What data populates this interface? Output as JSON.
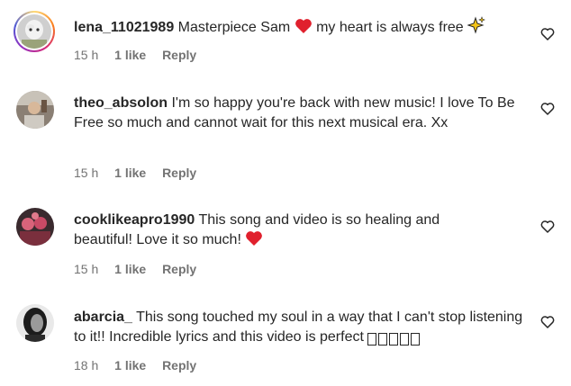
{
  "comments": [
    {
      "username": "lena_11021989",
      "text_before_emoji": "Masterpiece Sam",
      "text_after_emoji": "my heart is always free",
      "time": "15 h",
      "likes": "1 like",
      "reply": "Reply"
    },
    {
      "username": "theo_absolon",
      "text": "I'm so happy you're back with new music! I love To Be Free so much and cannot wait for this next musical era. Xx",
      "time": "15 h",
      "likes": "1 like",
      "reply": "Reply"
    },
    {
      "username": "cooklikeapro1990",
      "text": "This song and video is so healing and beautiful! Love it so much!",
      "time": "15 h",
      "likes": "1 like",
      "reply": "Reply"
    },
    {
      "username": "abarcia_",
      "text": "This song touched my soul in a way that I can't stop listening to it!! Incredible lyrics and this video is perfect",
      "time": "18 h",
      "likes": "1 like",
      "reply": "Reply"
    }
  ],
  "colors": {
    "text": "#262626",
    "meta": "#737373",
    "heart_emoji": "#e0202d"
  },
  "icons": [
    "heart-emoji-icon",
    "sparkles-emoji-icon",
    "like-heart-icon",
    "missing-glyph-icon"
  ]
}
